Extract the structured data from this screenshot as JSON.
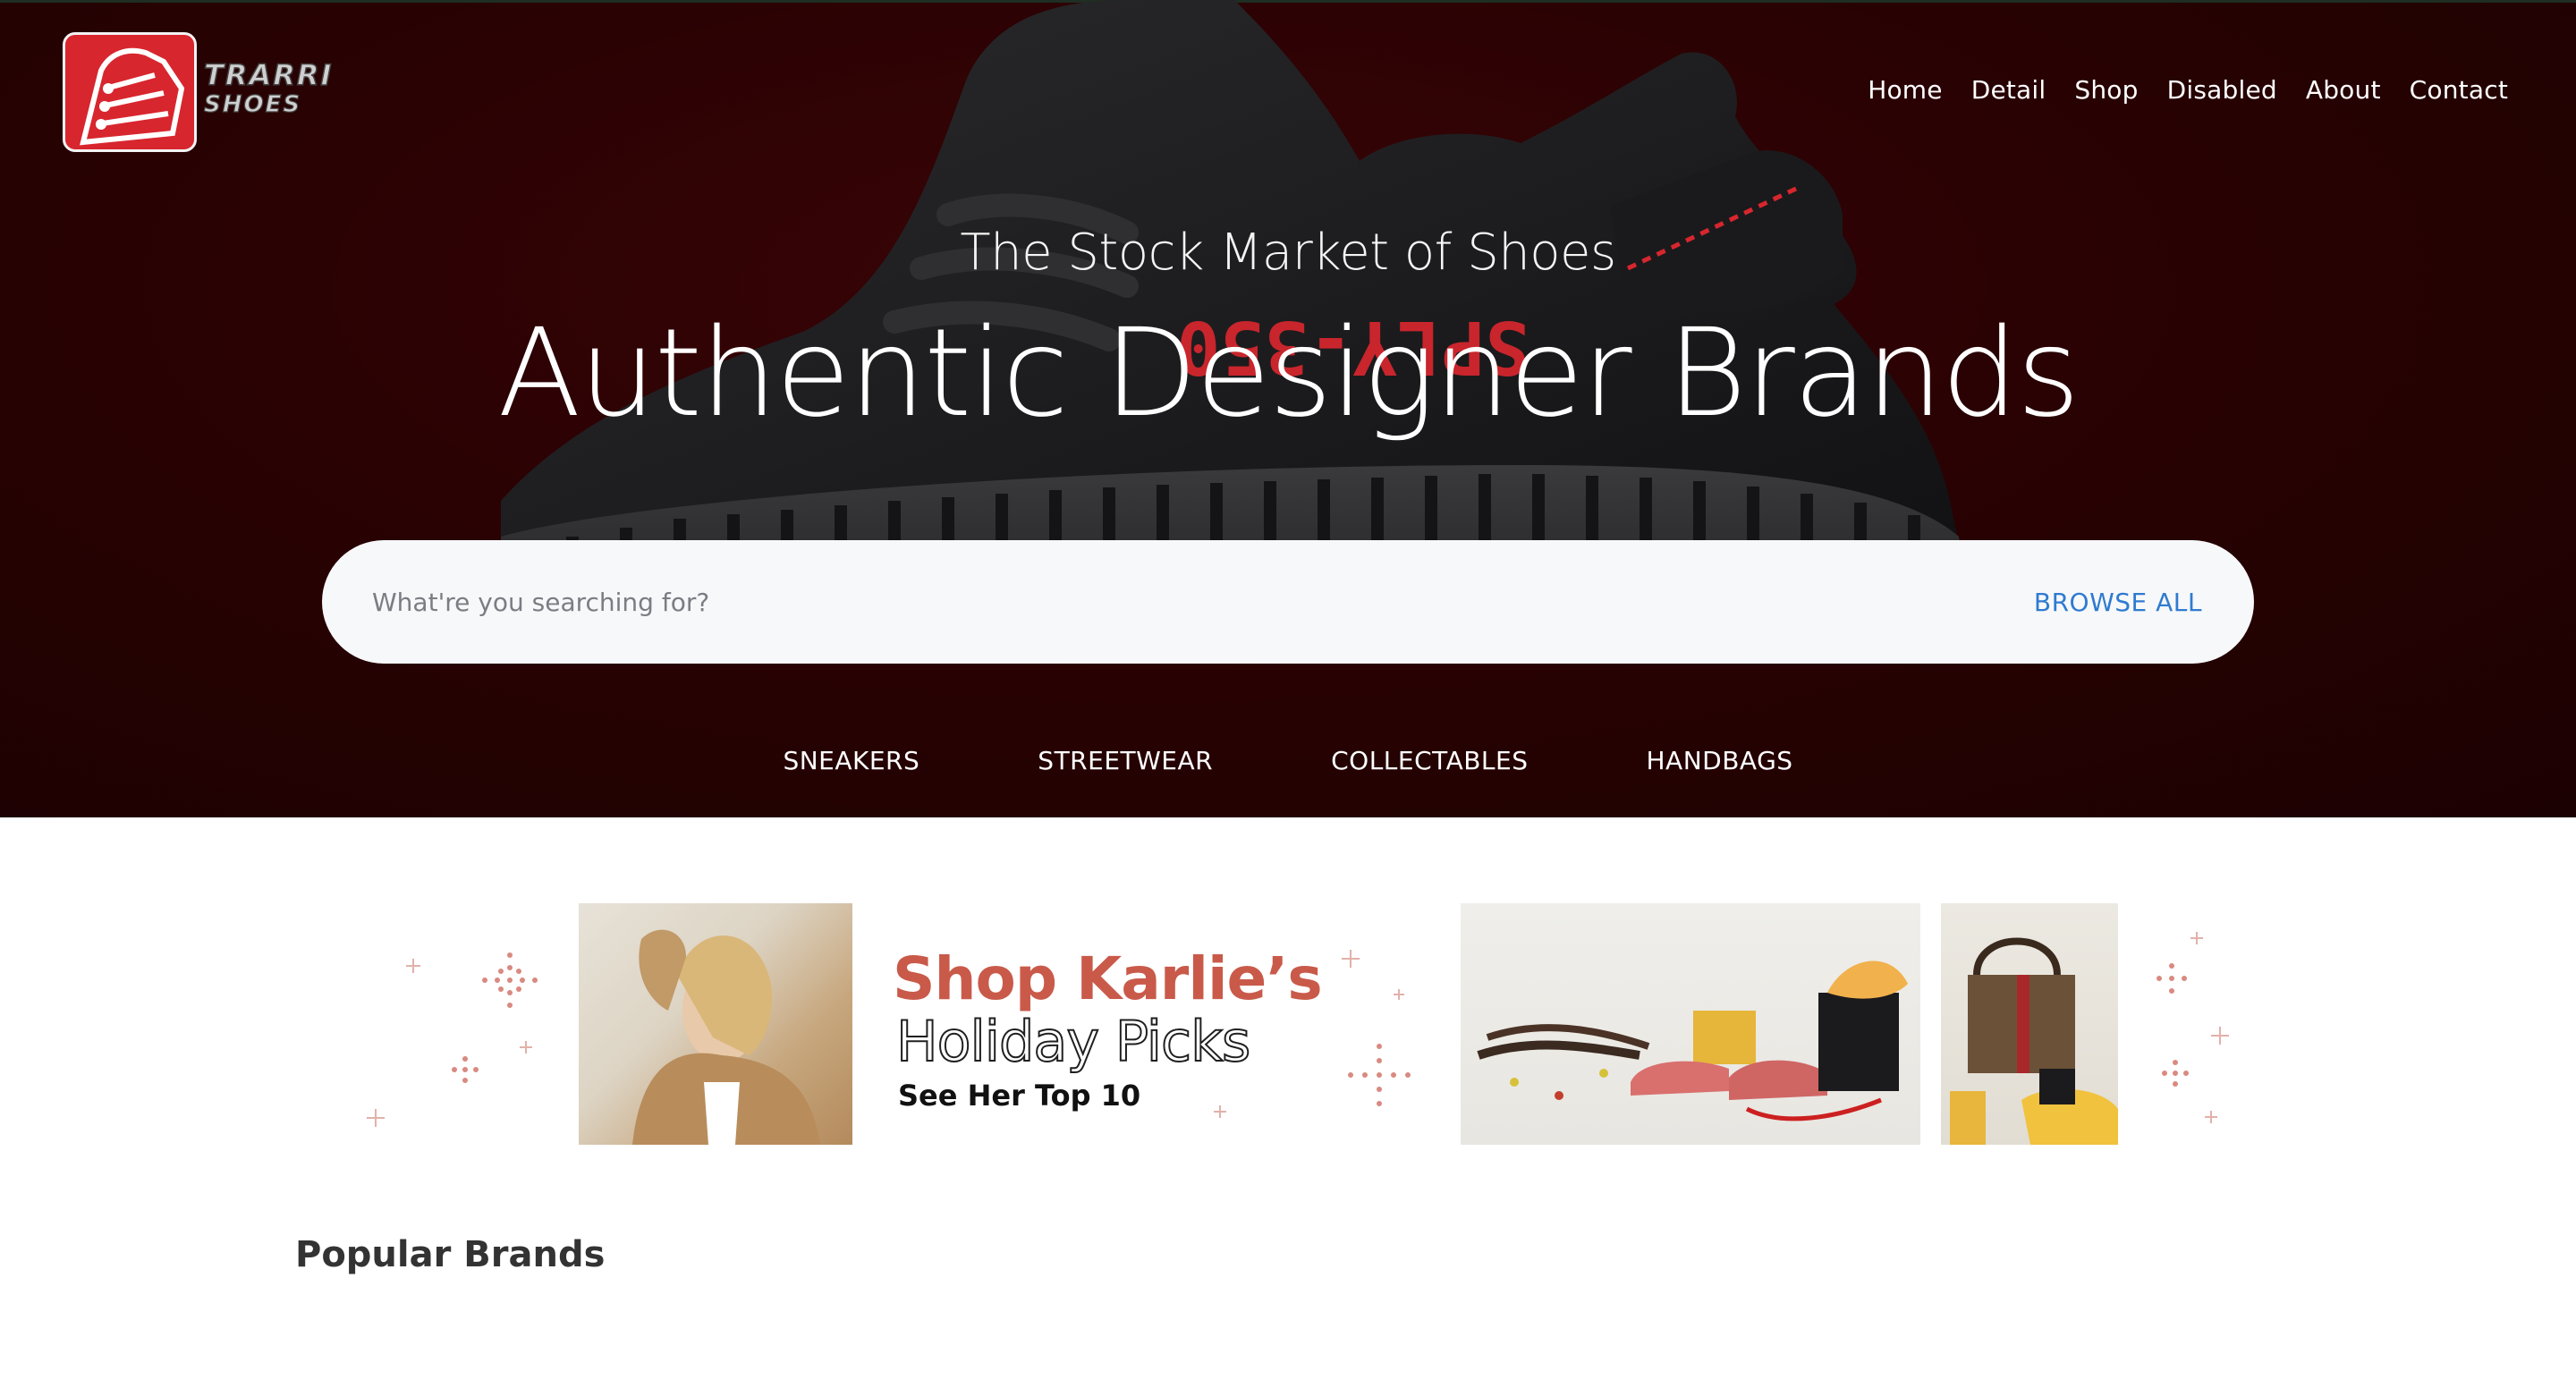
{
  "brand": {
    "name": "TRARRI",
    "sub": "SHOES"
  },
  "nav": {
    "items": [
      {
        "label": "Home"
      },
      {
        "label": "Detail"
      },
      {
        "label": "Shop"
      },
      {
        "label": "Disabled"
      },
      {
        "label": "About"
      },
      {
        "label": "Contact"
      }
    ]
  },
  "hero": {
    "tagline": "The Stock Market of Shoes",
    "headline": "Authentic Designer Brands",
    "shoe_print": "SPLY-350"
  },
  "search": {
    "placeholder": "What're you searching for?",
    "browse_label": "BROWSE ALL"
  },
  "categories": [
    {
      "label": "SNEAKERS"
    },
    {
      "label": "STREETWEAR"
    },
    {
      "label": "COLLECTABLES"
    },
    {
      "label": "HANDBAGS"
    }
  ],
  "promo": {
    "title": "Shop Karlie’s",
    "subtitle": "Holiday Picks",
    "cta": "See Her Top 10"
  },
  "sections": {
    "popular_brands": "Popular Brands"
  },
  "colors": {
    "hero_bg": "#2a0203",
    "accent_link": "#2f7bd0",
    "promo_title": "#c95a4a",
    "logo_red": "#d8262e"
  }
}
